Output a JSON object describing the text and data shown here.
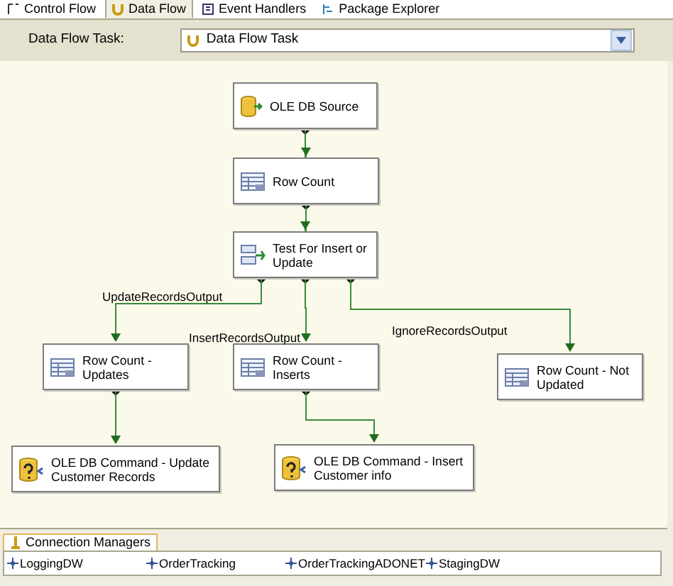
{
  "tabs": [
    {
      "label": "Control Flow",
      "selected": false,
      "kind": "control"
    },
    {
      "label": "Data Flow",
      "selected": true,
      "kind": "dataflow"
    },
    {
      "label": "Event Handlers",
      "selected": false,
      "kind": "events"
    },
    {
      "label": "Package Explorer",
      "selected": false,
      "kind": "explorer"
    }
  ],
  "toolbar": {
    "label": "Data Flow Task:",
    "task": "Data Flow Task"
  },
  "nodes": [
    {
      "label": "OLE DB Source",
      "kind": "source"
    },
    {
      "label": "Row Count",
      "kind": "rowcount"
    },
    {
      "label": "Test For Insert or Update",
      "kind": "split"
    },
    {
      "label": "Row Count - Updates",
      "kind": "rowcount"
    },
    {
      "label": "Row Count - Inserts",
      "kind": "rowcount"
    },
    {
      "label": "Row Count - Not Updated",
      "kind": "rowcount"
    },
    {
      "label": "OLE DB Command - Update Customer Records",
      "kind": "command"
    },
    {
      "label": "OLE DB Command - Insert Customer info",
      "kind": "command"
    }
  ],
  "edge_labels": [
    "UpdateRecordsOutput",
    "InsertRecordsOutput",
    "IgnoreRecordsOutput"
  ],
  "connection_managers": {
    "title": "Connection Managers",
    "items": [
      "LoggingDW",
      "OrderTracking",
      "OrderTrackingADONET",
      "StagingDW"
    ]
  }
}
